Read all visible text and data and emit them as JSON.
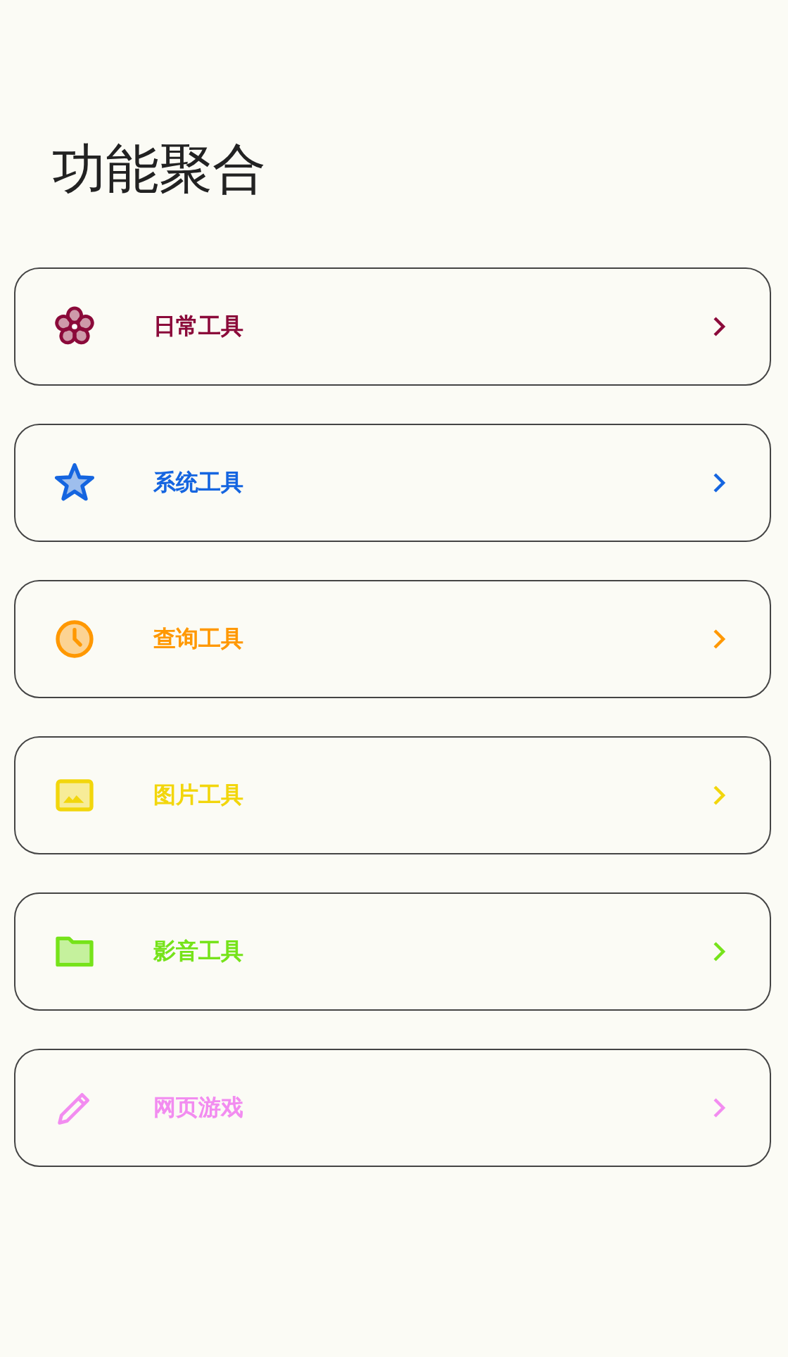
{
  "title": "功能聚合",
  "items": [
    {
      "kind": "flower",
      "label": "日常工具",
      "color": "#8b0a3a"
    },
    {
      "kind": "star",
      "label": "系统工具",
      "color": "#1565e0"
    },
    {
      "kind": "clock",
      "label": "查询工具",
      "color": "#ff9800"
    },
    {
      "kind": "image",
      "label": "图片工具",
      "color": "#f2d60c"
    },
    {
      "kind": "folder",
      "label": "影音工具",
      "color": "#76e31a"
    },
    {
      "kind": "pencil",
      "label": "网页游戏",
      "color": "#f28cf0"
    }
  ]
}
